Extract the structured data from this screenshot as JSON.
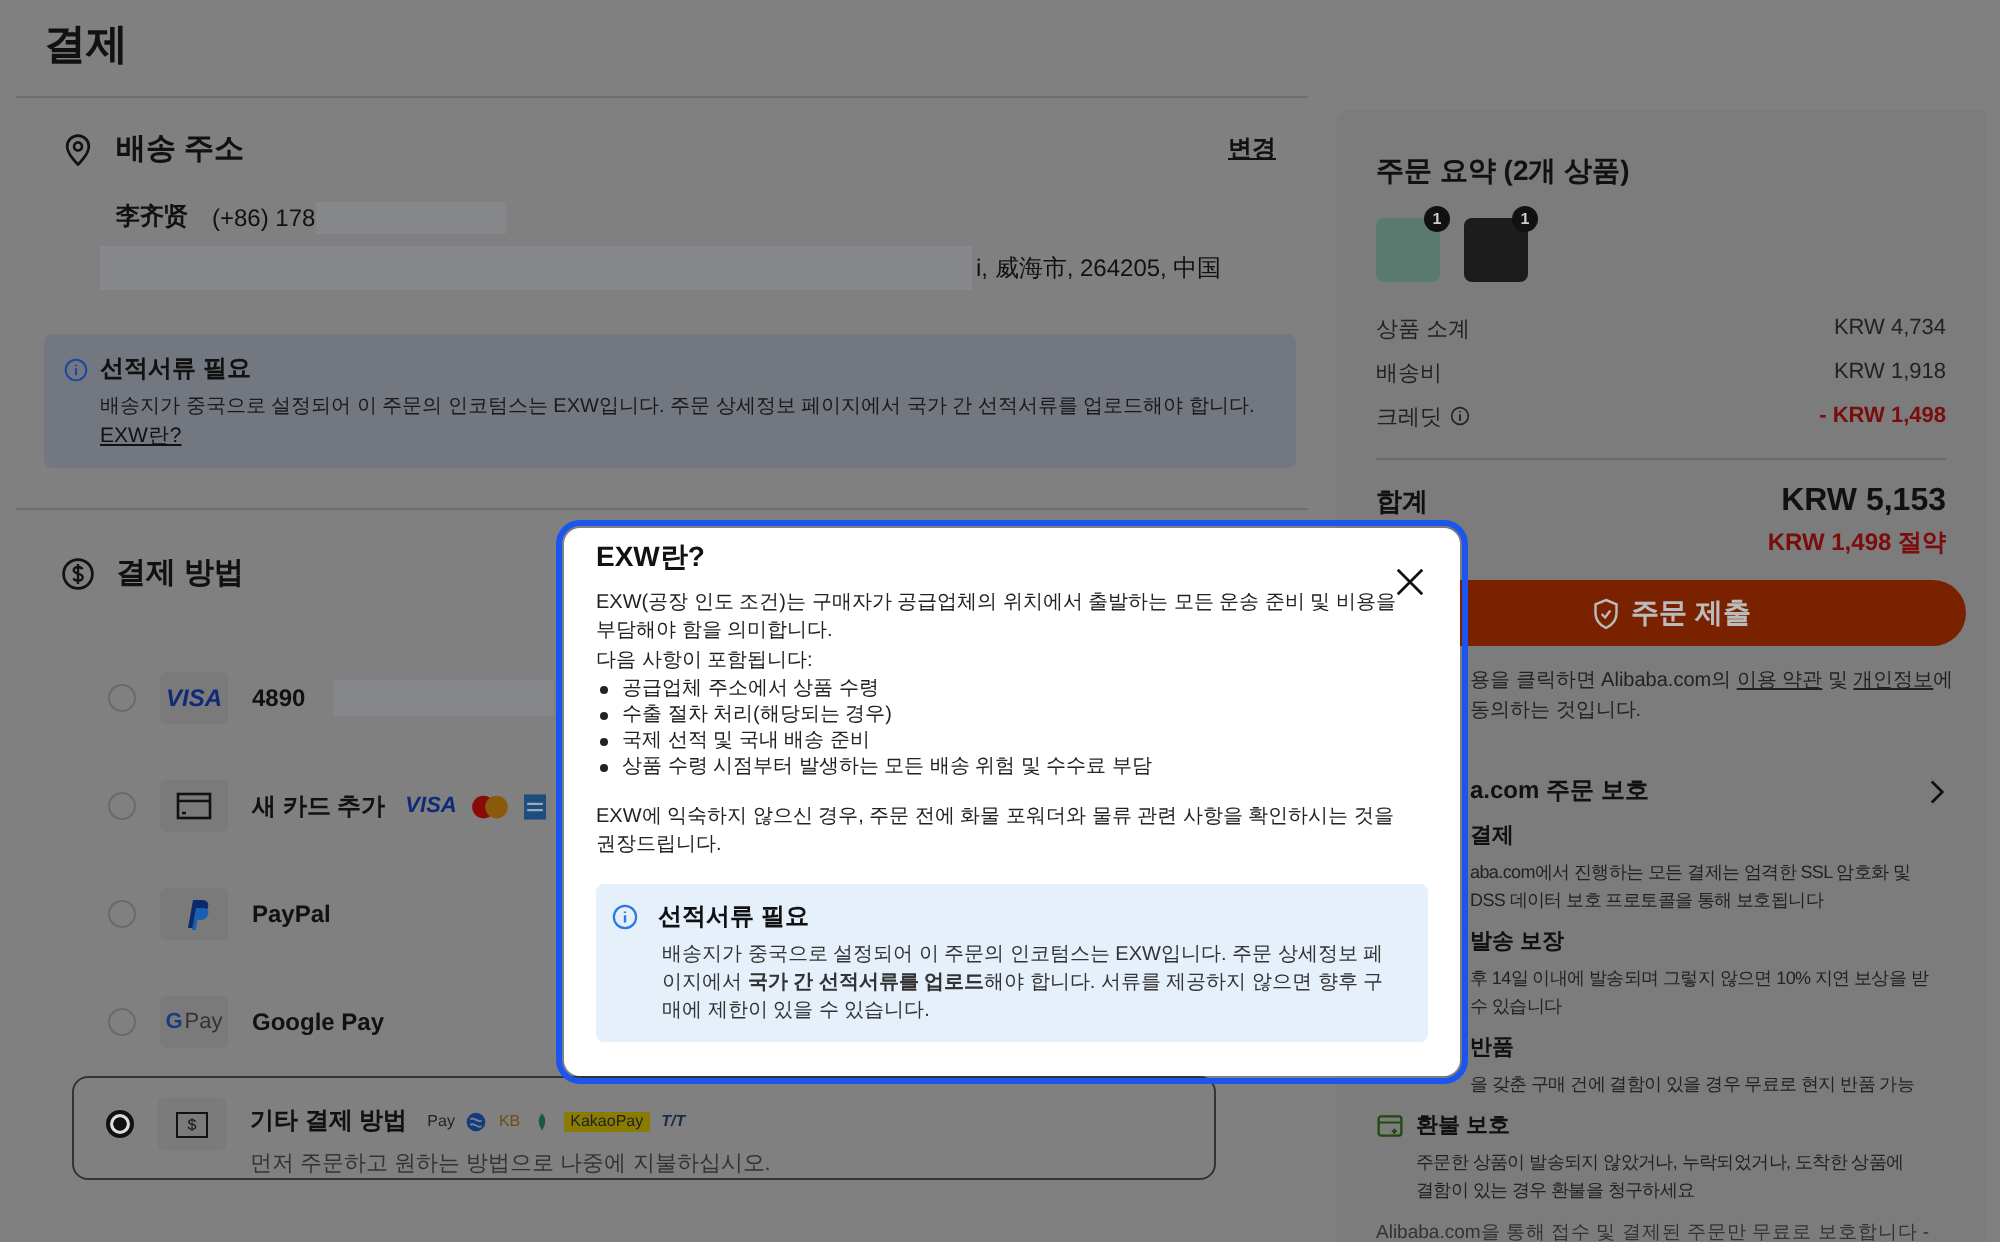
{
  "page_title": "결제",
  "shipping": {
    "title": "배송 주소",
    "change_link": "변경",
    "name": "李齐贤",
    "phone": "(+86) 178",
    "address_tail": "i, 威海市, 264205, 中国"
  },
  "notice": {
    "title": "선적서류 필요",
    "text": "배송지가 중국으로 설정되어 이 주문의 인코텀스는 EXW입니다. 주문 상세정보 페이지에서 국가 간 선적서류를 업로드해야 합니다.",
    "link": "EXW란?"
  },
  "payment": {
    "title": "결제 방법",
    "methods": [
      {
        "kind": "visa",
        "icon_text": "VISA",
        "label": "4890",
        "selected": false
      },
      {
        "kind": "card",
        "label": "새 카드 추가",
        "selected": false,
        "logos": [
          {
            "kind": "visa",
            "text": "VISA"
          },
          {
            "kind": "mastercard"
          },
          {
            "kind": "amex"
          }
        ]
      },
      {
        "kind": "paypal",
        "label": "PayPal",
        "selected": false
      },
      {
        "kind": "gpay",
        "icon_letter": "G",
        "icon_text": "Pay",
        "label": "Google Pay",
        "selected": false
      },
      {
        "kind": "other",
        "icon_text": "$",
        "label": "기타 결제 방법",
        "selected": true,
        "note": "먼저 주문하고 원하는 방법으로 나중에 지불하십시오.",
        "logos": [
          {
            "kind": "applepay",
            "text": "Pay"
          },
          {
            "kind": "globe"
          },
          {
            "kind": "kb",
            "text": "KB"
          },
          {
            "kind": "leaf"
          },
          {
            "kind": "kakaopay",
            "text": "KakaoPay"
          },
          {
            "kind": "tt",
            "text": "T/T"
          }
        ]
      }
    ]
  },
  "summary": {
    "title": "주문 요약 (2개 상품)",
    "products": [
      {
        "count": "1",
        "kind": "mint"
      },
      {
        "count": "1",
        "kind": "black"
      }
    ],
    "rows": [
      {
        "label": "상품 소계",
        "value": "KRW 4,734",
        "info": false,
        "discount": false
      },
      {
        "label": "배송비",
        "value": "KRW 1,918",
        "info": false,
        "discount": false
      },
      {
        "label": "크레딧",
        "value": "- KRW 1,498",
        "info": true,
        "discount": true
      }
    ],
    "total_label": "합계",
    "total": "KRW 5,153",
    "savings": "KRW 1,498 절약",
    "submit": "주문 제출",
    "terms": [
      {
        "text": "용을 클릭하면 Alibaba.com의 ",
        "link": false
      },
      {
        "text": "이용 약관",
        "link": true
      },
      {
        "text": " 및 ",
        "link": false
      },
      {
        "text": "개인정보",
        "link": true
      },
      {
        "text": "에 동의하는 것입니다.",
        "link": false
      }
    ]
  },
  "protection": {
    "title": "a.com 주문 보호",
    "items": [
      {
        "title": "결제",
        "icon": false,
        "lines": [
          "aba.com에서 진행하는 모든 결제는 엄격한 SSL 암호화 및",
          "DSS 데이터 보호 프로토콜을 통해 보호됩니다"
        ]
      },
      {
        "title": "발송 보장",
        "icon": false,
        "lines": [
          "후 14일 이내에 발송되며 그렇지 않으면 10% 지연 보상을 받",
          "수 있습니다"
        ]
      },
      {
        "title": "반품",
        "icon": false,
        "lines": [
          "을 갖춘 구매 건에 결함이 있을 경우 무료로 현지 반품 가능"
        ]
      },
      {
        "title": "환불 보호",
        "icon": true,
        "lines": [
          "주문한 상품이 발송되지 않았거나, 누락되었거나, 도착한 상품에",
          "결함이 있는 경우 환불을 청구하세요"
        ]
      }
    ],
    "footer": "Alibaba.com을 통해 접수 및 결제된 주문만 무료로 보호합니다 -"
  },
  "dialog": {
    "title": "EXW란?",
    "intro": "EXW(공장 인도 조건)는 구매자가 공급업체의 위치에서 출발하는 모든 운송 준비 및 비용을 부담해야 함을 의미합니다.",
    "list_title": "다음 사항이 포함됩니다:",
    "bullets": [
      "공급업체 주소에서 상품 수령",
      "수출 절차 처리(해당되는 경우)",
      "국제 선적 및 국내 배송 준비",
      "상품 수령 시점부터 발생하는 모든 배송 위험 및 수수료 부담"
    ],
    "advice": "EXW에 익숙하지 않으신 경우, 주문 전에 화물 포워더와 물류 관련 사항을 확인하시는 것을 권장드립니다.",
    "notice_title": "선적서류 필요",
    "notice_text": "배송지가 중국으로 설정되어 이 주문의 인코텀스는 EXW입니다. 주문 상세정보 페이지에서 **국가 간 선적서류를 업로드**해야 합니다. 서류를 제공하지 않으면 향후 구매에 제한이 있을 수 있습니다."
  }
}
